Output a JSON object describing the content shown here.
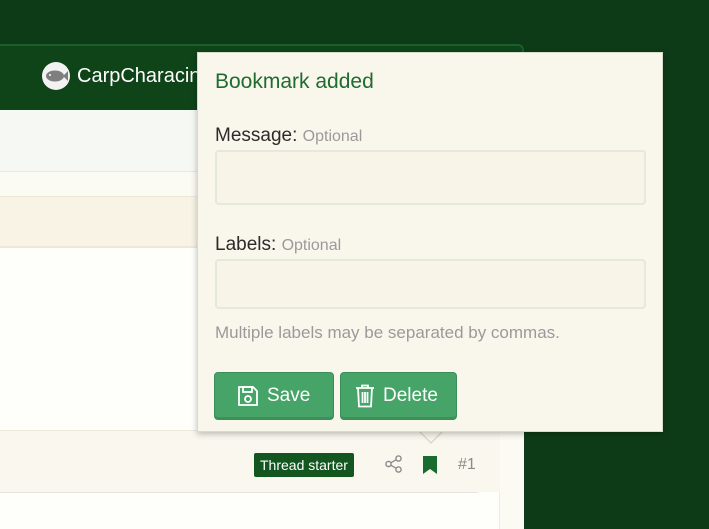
{
  "site": {
    "logo_text": "CarpCharacin"
  },
  "post": {
    "thread_starter_badge": "Thread starter",
    "post_number": "#1"
  },
  "bookmark_popup": {
    "title": "Bookmark added",
    "message_label": "Message:",
    "message_optional": "Optional",
    "message_value": "",
    "labels_label": "Labels:",
    "labels_optional": "Optional",
    "labels_value": "",
    "hint": "Multiple labels may be separated by commas.",
    "save_label": "Save",
    "delete_label": "Delete"
  },
  "colors": {
    "header_bg": "#0f4419",
    "page_bg": "#0d3b17",
    "accent_green": "#1f6b30",
    "button_green": "#47a468",
    "badge_green": "#13561f",
    "popup_bg": "#f9f6ec"
  },
  "icons": {
    "logo": "fish-icon",
    "share": "share-icon",
    "bookmark": "bookmark-icon",
    "save": "floppy-disk-icon",
    "delete": "trash-icon"
  }
}
